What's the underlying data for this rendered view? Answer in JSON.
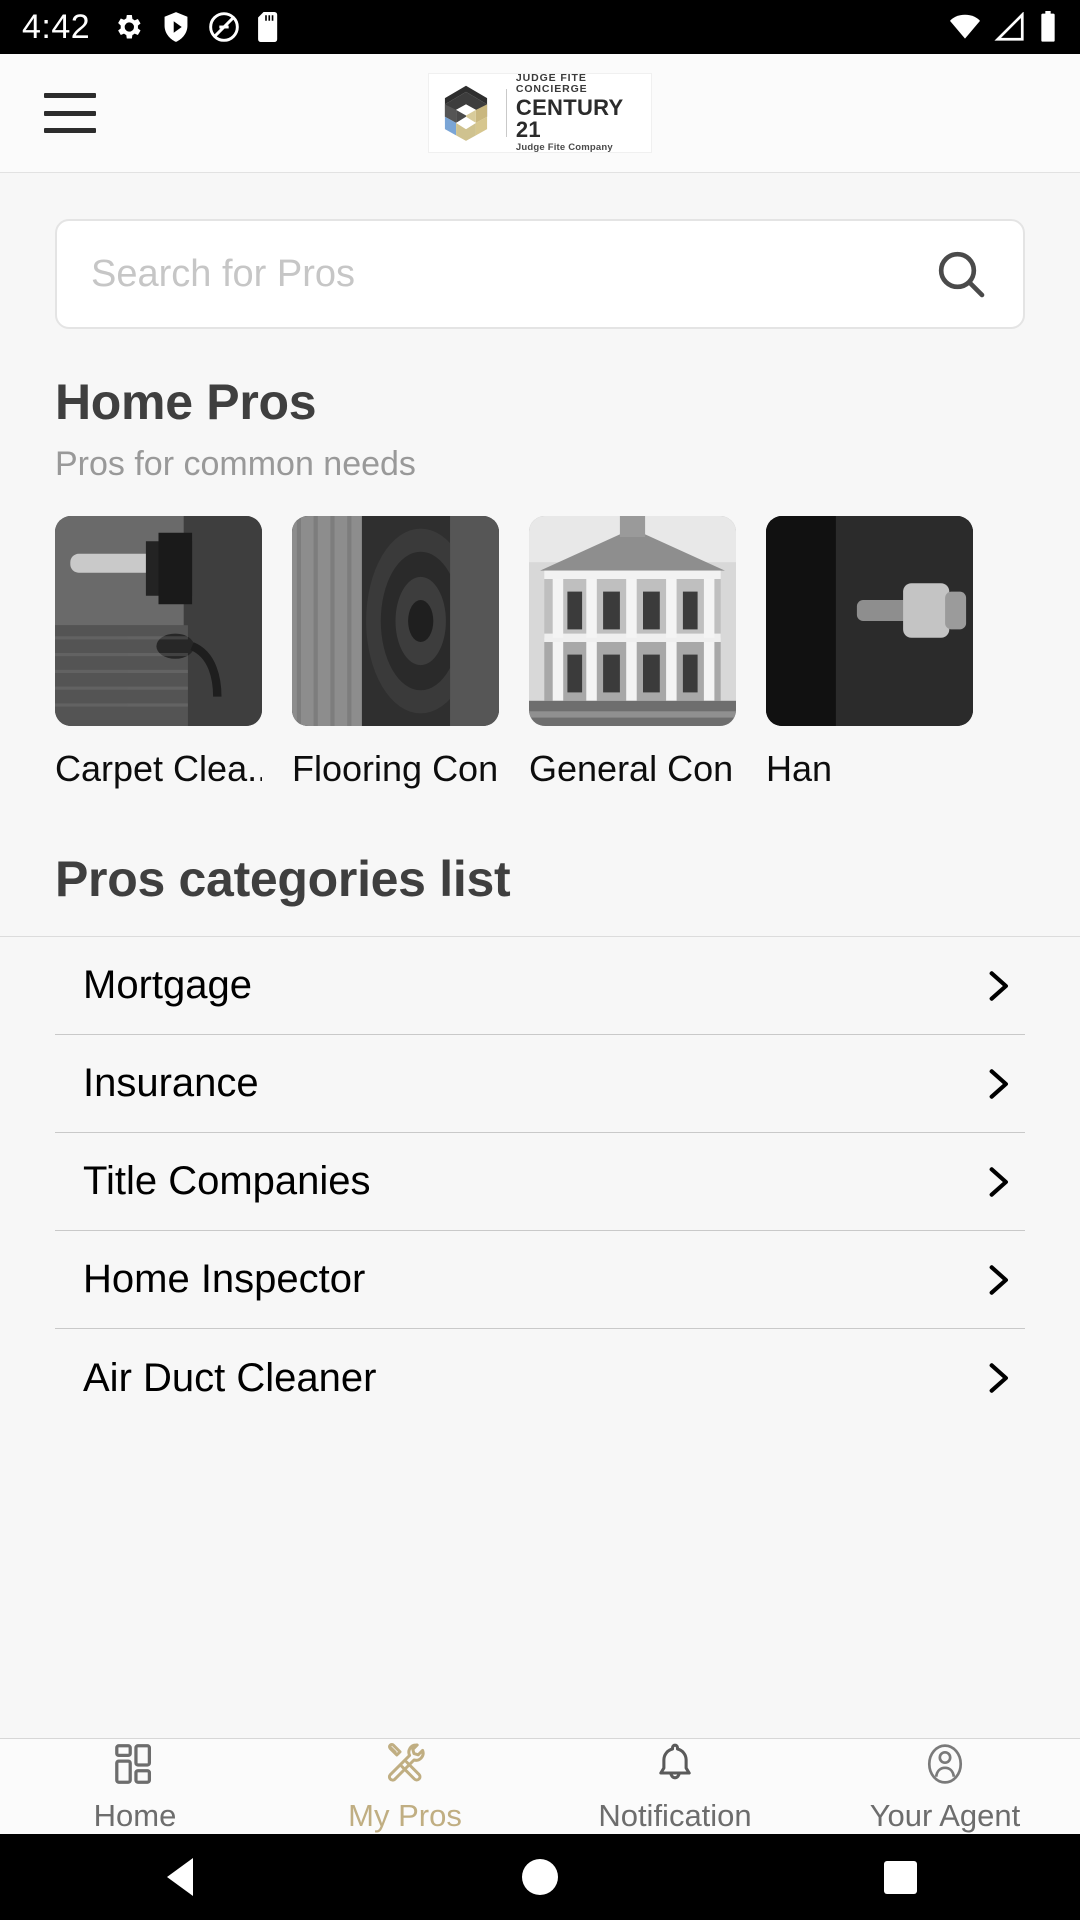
{
  "statusbar": {
    "time": "4:42",
    "left_icons": [
      "settings-gear-icon",
      "play-protect-icon",
      "do-not-disturb-icon",
      "sd-card-icon"
    ],
    "right_icons": [
      "wifi-icon",
      "cellular-signal-icon",
      "battery-icon"
    ]
  },
  "appbar": {
    "menu_icon": "hamburger-menu-icon",
    "logo": {
      "line1": "JUDGE FITE CONCIERGE",
      "line2": "CENTURY 21",
      "line3": "Judge Fite Company"
    }
  },
  "search": {
    "placeholder": "Search for Pros",
    "value": "",
    "icon": "search-icon"
  },
  "home_pros": {
    "title": "Home Pros",
    "subtitle": "Pros for common needs",
    "cards": [
      {
        "label": "Carpet Clea...",
        "image": "carpet-vacuum-photo"
      },
      {
        "label": "Flooring Con...",
        "image": "rolled-carpet-photo"
      },
      {
        "label": "General Con...",
        "image": "colonial-house-photo"
      },
      {
        "label": "Han",
        "image": "handyman-tool-photo"
      }
    ]
  },
  "categories": {
    "title": "Pros categories list",
    "items": [
      {
        "label": "Mortgage",
        "chevron": "chevron-right-icon"
      },
      {
        "label": "Insurance",
        "chevron": "chevron-right-icon"
      },
      {
        "label": "Title Companies",
        "chevron": "chevron-right-icon"
      },
      {
        "label": "Home Inspector",
        "chevron": "chevron-right-icon"
      },
      {
        "label": "Air Duct Cleaner",
        "chevron": "chevron-right-icon"
      }
    ]
  },
  "bottom_nav": {
    "active_color": "#c0ae82",
    "items": [
      {
        "label": "Home",
        "icon": "grid-dashboard-icon",
        "active": false
      },
      {
        "label": "My Pros",
        "icon": "crossed-tools-icon",
        "active": true
      },
      {
        "label": "Notification",
        "icon": "bell-icon",
        "active": false
      },
      {
        "label": "Your Agent",
        "icon": "person-avatar-icon",
        "active": false
      }
    ]
  },
  "system_nav": {
    "back": "back-triangle-icon",
    "home": "home-circle-icon",
    "recents": "recents-square-icon"
  }
}
